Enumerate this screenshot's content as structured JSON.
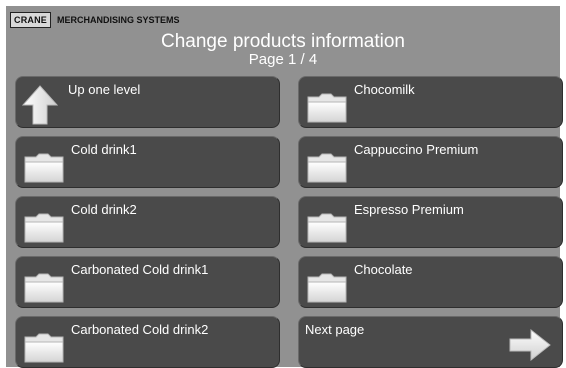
{
  "brand": {
    "logo": "CRANE",
    "name": "MERCHANDISING SYSTEMS"
  },
  "header": {
    "title": "Change products information",
    "page": "Page 1 / 4"
  },
  "buttons": {
    "up": "Up one level",
    "left": [
      "Cold drink1",
      "Cold drink2",
      "Carbonated Cold drink1",
      "Carbonated Cold drink2"
    ],
    "right": [
      "Chocomilk",
      "Cappuccino Premium",
      "Espresso Premium",
      "Chocolate"
    ],
    "next": "Next page"
  },
  "icons": {
    "up": "arrow-up-icon",
    "folder": "folder-icon",
    "next": "arrow-right-icon"
  }
}
